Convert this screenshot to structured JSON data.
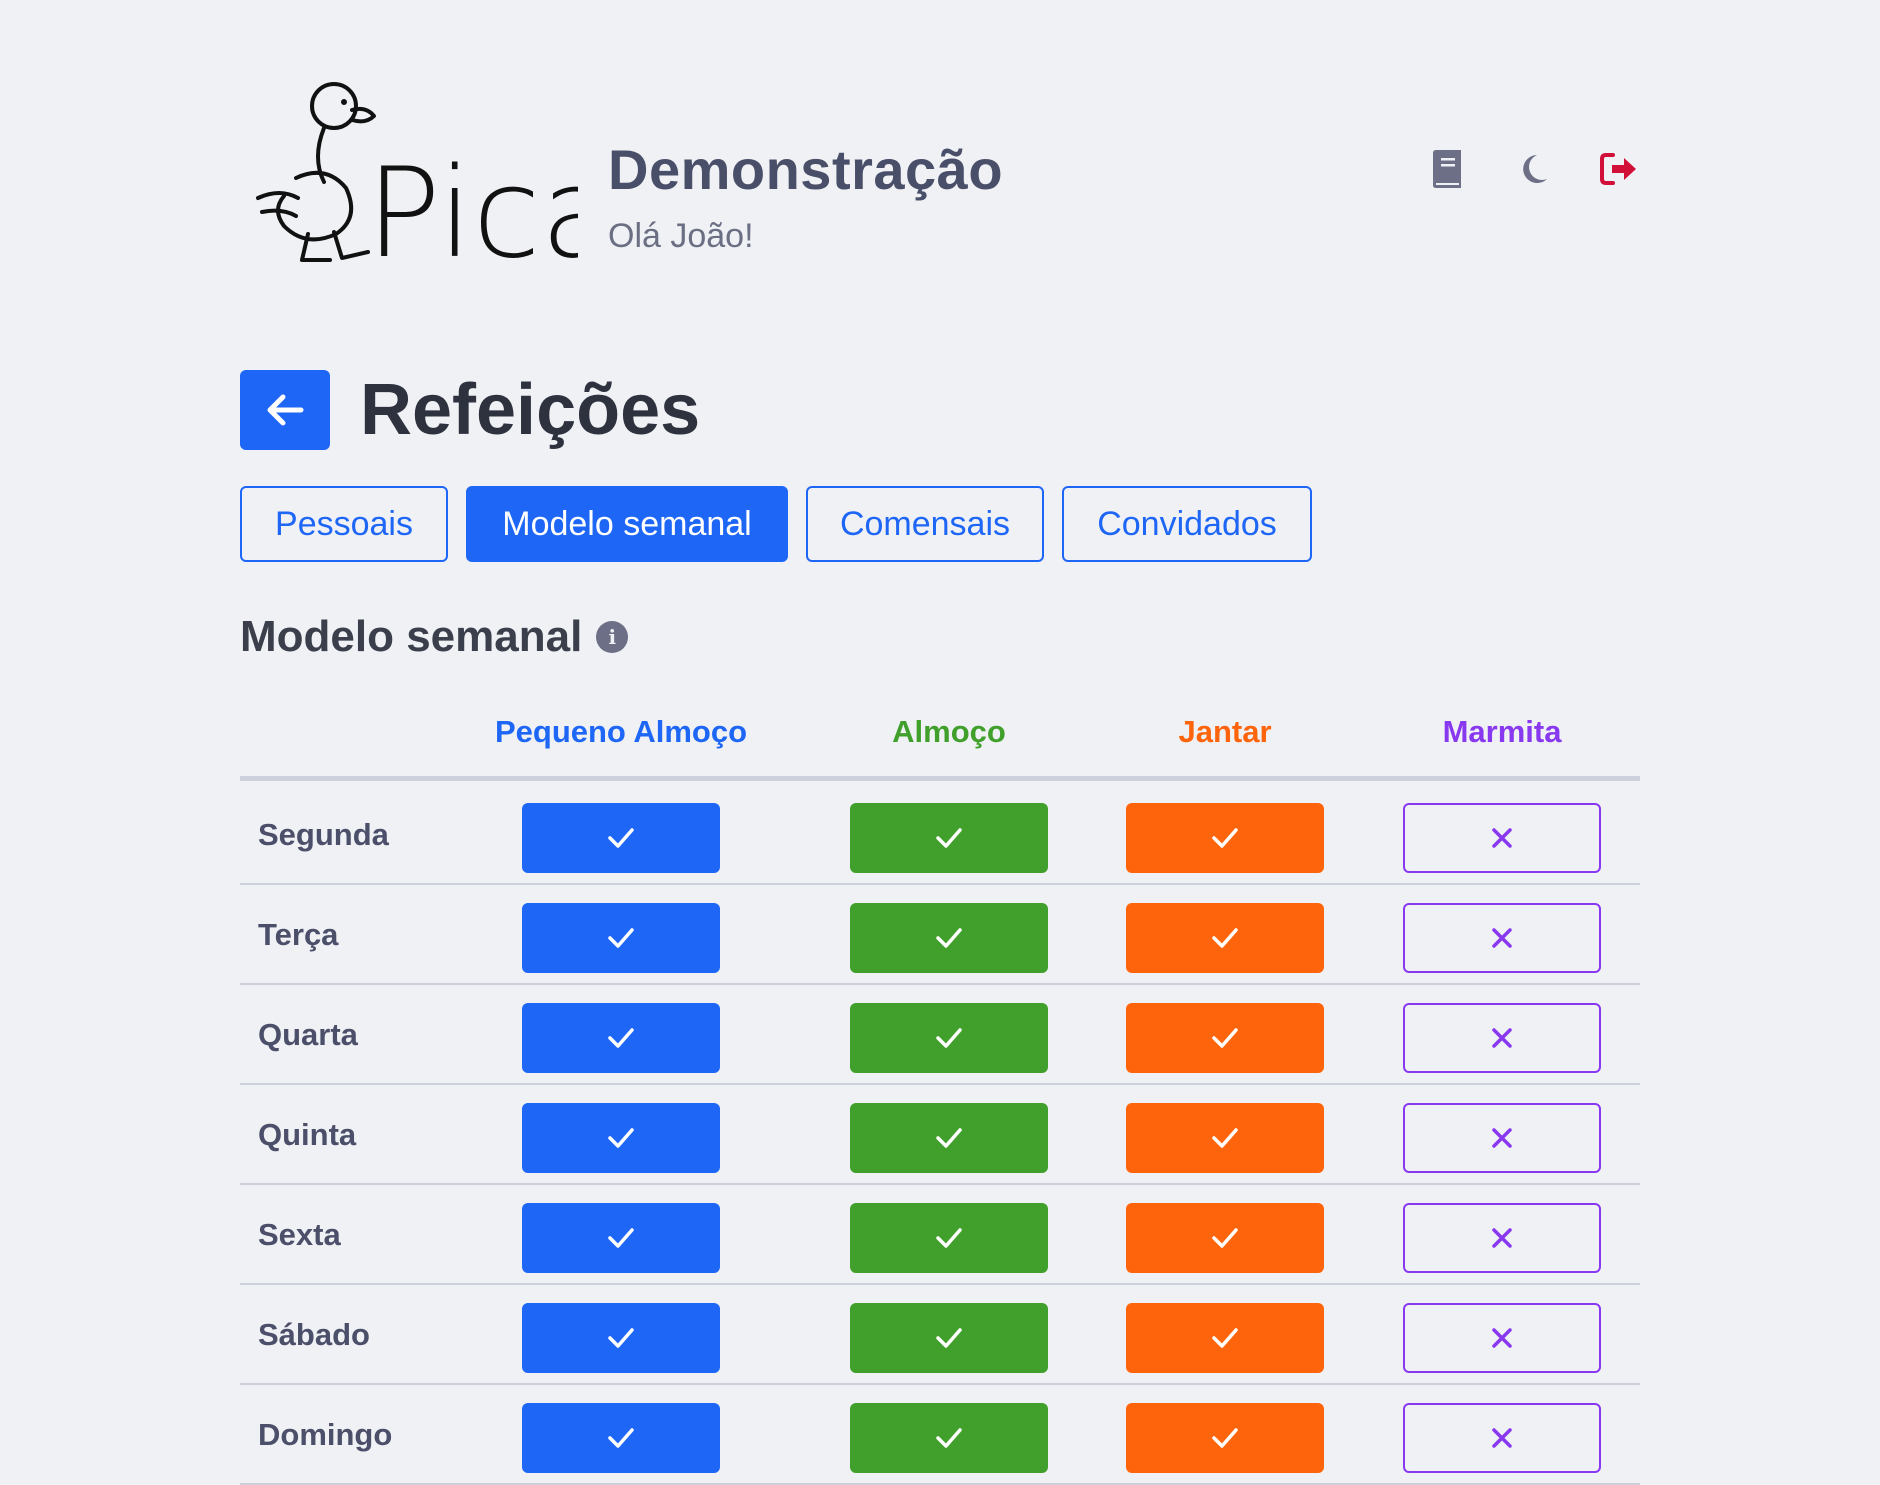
{
  "header": {
    "logo_text": "Pica",
    "title": "Demonstração",
    "subtitle": "Olá João!",
    "icons": [
      "book-icon",
      "moon-icon",
      "logout-icon"
    ]
  },
  "page": {
    "title": "Refeições",
    "back_icon": "arrow-left-icon"
  },
  "tabs": [
    {
      "label": "Pessoais",
      "active": false
    },
    {
      "label": "Modelo semanal",
      "active": true
    },
    {
      "label": "Comensais",
      "active": false
    },
    {
      "label": "Convidados",
      "active": false
    }
  ],
  "section": {
    "title": "Modelo semanal",
    "info_icon": "info-icon"
  },
  "table": {
    "columns": [
      {
        "label": "Pequeno Almoço",
        "color": "#1e66f5"
      },
      {
        "label": "Almoço",
        "color": "#40a02b"
      },
      {
        "label": "Jantar",
        "color": "#fe640b"
      },
      {
        "label": "Marmita",
        "color": "#8839ef"
      }
    ],
    "rows": [
      {
        "day": "Segunda",
        "values": [
          true,
          true,
          true,
          false
        ]
      },
      {
        "day": "Terça",
        "values": [
          true,
          true,
          true,
          false
        ]
      },
      {
        "day": "Quarta",
        "values": [
          true,
          true,
          true,
          false
        ]
      },
      {
        "day": "Quinta",
        "values": [
          true,
          true,
          true,
          false
        ]
      },
      {
        "day": "Sexta",
        "values": [
          true,
          true,
          true,
          false
        ]
      },
      {
        "day": "Sábado",
        "values": [
          true,
          true,
          true,
          false
        ]
      },
      {
        "day": "Domingo",
        "values": [
          true,
          true,
          true,
          false
        ]
      }
    ]
  }
}
